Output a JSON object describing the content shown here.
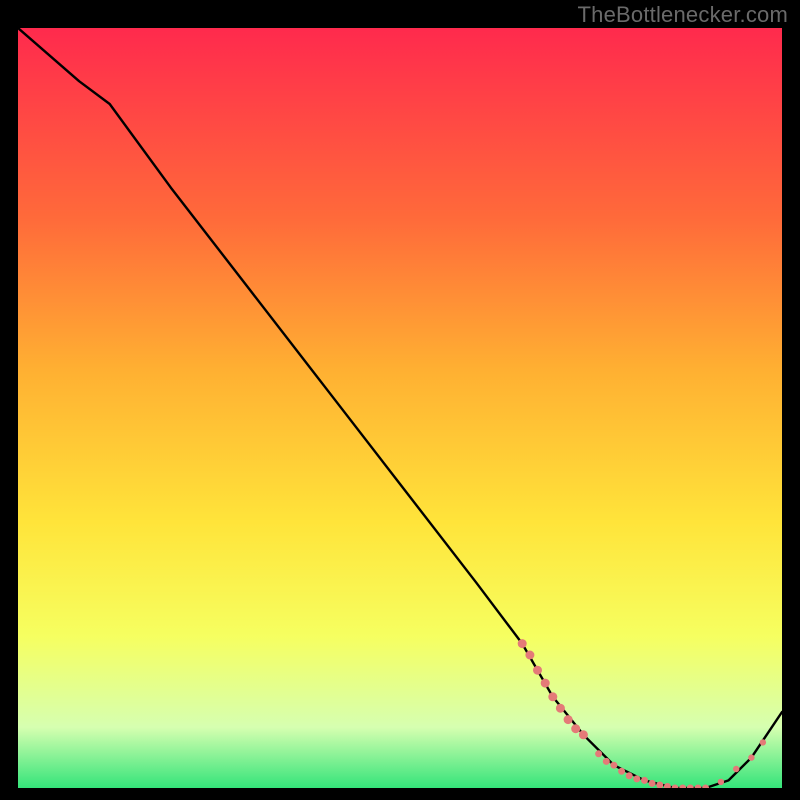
{
  "watermark": "TheBottlenecker.com",
  "colors": {
    "bg": "#000000",
    "watermark": "#6a6a6a",
    "curve": "#000000",
    "marker_fill": "#e47a78",
    "marker_stroke": "#d86b68",
    "grad_top": "#ff2a4d",
    "grad_mid1": "#ff6a3a",
    "grad_mid2": "#ffb032",
    "grad_mid3": "#ffe43a",
    "grad_mid4": "#f6ff60",
    "grad_mid5": "#d6ffb0",
    "grad_bot": "#34e47a"
  },
  "chart_data": {
    "type": "line",
    "title": "",
    "xlabel": "",
    "ylabel": "",
    "xlim": [
      0,
      100
    ],
    "ylim": [
      0,
      100
    ],
    "series": [
      {
        "name": "bottleneck-curve",
        "x": [
          0,
          8,
          12,
          20,
          30,
          40,
          50,
          60,
          66,
          70,
          74,
          78,
          82,
          86,
          90,
          93,
          96,
          100
        ],
        "y": [
          100,
          93,
          90,
          79,
          66,
          53,
          40,
          27,
          19,
          12,
          7,
          3,
          1,
          0,
          0,
          1,
          4,
          10
        ]
      }
    ],
    "markers": {
      "name": "highlight-band",
      "points": [
        {
          "x": 66,
          "y": 19,
          "r": 4.5
        },
        {
          "x": 67,
          "y": 17.5,
          "r": 4.5
        },
        {
          "x": 68,
          "y": 15.5,
          "r": 4.5
        },
        {
          "x": 69,
          "y": 13.8,
          "r": 4.5
        },
        {
          "x": 70,
          "y": 12.0,
          "r": 4.5
        },
        {
          "x": 71,
          "y": 10.5,
          "r": 4.5
        },
        {
          "x": 72,
          "y": 9.0,
          "r": 4.5
        },
        {
          "x": 73,
          "y": 7.8,
          "r": 4.5
        },
        {
          "x": 74,
          "y": 7.0,
          "r": 4.5
        },
        {
          "x": 76,
          "y": 4.5,
          "r": 3.5
        },
        {
          "x": 77,
          "y": 3.5,
          "r": 3.5
        },
        {
          "x": 78,
          "y": 3.0,
          "r": 3.5
        },
        {
          "x": 79,
          "y": 2.2,
          "r": 3.5
        },
        {
          "x": 80,
          "y": 1.6,
          "r": 3.5
        },
        {
          "x": 81,
          "y": 1.2,
          "r": 3.5
        },
        {
          "x": 82,
          "y": 1.0,
          "r": 3.5
        },
        {
          "x": 83,
          "y": 0.6,
          "r": 3.5
        },
        {
          "x": 84,
          "y": 0.4,
          "r": 3.5
        },
        {
          "x": 85,
          "y": 0.2,
          "r": 3.5
        },
        {
          "x": 86,
          "y": 0.0,
          "r": 3.5
        },
        {
          "x": 87,
          "y": 0.0,
          "r": 3.5
        },
        {
          "x": 88,
          "y": 0.0,
          "r": 3.5
        },
        {
          "x": 89,
          "y": 0.0,
          "r": 3.5
        },
        {
          "x": 90,
          "y": 0.0,
          "r": 3.5
        },
        {
          "x": 92,
          "y": 0.8,
          "r": 3.2
        },
        {
          "x": 94,
          "y": 2.5,
          "r": 3.2
        },
        {
          "x": 96,
          "y": 4.0,
          "r": 3.2
        },
        {
          "x": 97.5,
          "y": 6.0,
          "r": 3.2
        }
      ]
    }
  }
}
